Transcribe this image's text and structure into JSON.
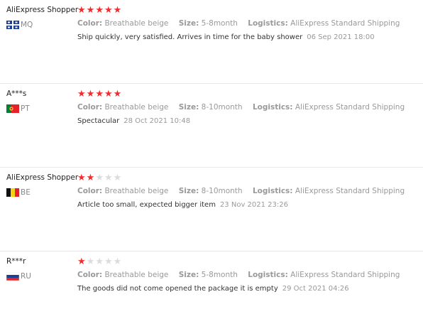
{
  "meta_labels": {
    "color": "Color:",
    "size": "Size:",
    "logistics": "Logistics:"
  },
  "reviews": [
    {
      "user": "AliExpress Shopper",
      "country": "MQ",
      "flag": "mq-flag-icon",
      "rating": 5,
      "color": "Breathable beige",
      "size": "5-8month",
      "logistics": "AliExpress Standard Shipping",
      "text": "Ship quickly, very satisfied. Arrives in time for the baby shower",
      "date": "06 Sep 2021 18:00"
    },
    {
      "user": "A***s",
      "country": "PT",
      "flag": "pt-flag-icon",
      "rating": 5,
      "color": "Breathable beige",
      "size": "8-10month",
      "logistics": "AliExpress Standard Shipping",
      "text": "Spectacular",
      "date": "28 Oct 2021 10:48"
    },
    {
      "user": "AliExpress Shopper",
      "country": "BE",
      "flag": "be-flag-icon",
      "rating": 2,
      "color": "Breathable beige",
      "size": "8-10month",
      "logistics": "AliExpress Standard Shipping",
      "text": "Article too small, expected bigger item",
      "date": "23 Nov 2021 23:26"
    },
    {
      "user": "R***r",
      "country": "RU",
      "flag": "ru-flag-icon",
      "rating": 1,
      "color": "Breathable beige",
      "size": "5-8month",
      "logistics": "AliExpress Standard Shipping",
      "text": "The goods did not come opened the package it is empty",
      "date": "29 Oct 2021 04:26"
    }
  ],
  "colors": {
    "star_on": "#f52b2b",
    "star_off": "#dcdcdc",
    "meta_text": "#999999",
    "divider": "#e8e8e8"
  }
}
